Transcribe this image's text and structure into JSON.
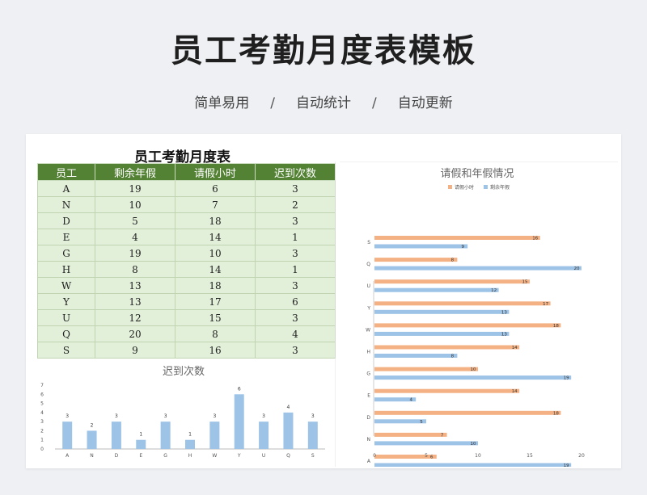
{
  "page": {
    "title": "员工考勤月度表模板",
    "features": [
      "简单易用",
      "自动统计",
      "自动更新"
    ],
    "separator": "/"
  },
  "table": {
    "title": "员工考勤月度表",
    "headers": [
      "员工",
      "剩余年假",
      "请假小时",
      "迟到次数"
    ],
    "rows": [
      [
        "A",
        "19",
        "6",
        "3"
      ],
      [
        "N",
        "10",
        "7",
        "2"
      ],
      [
        "D",
        "5",
        "18",
        "3"
      ],
      [
        "E",
        "4",
        "14",
        "1"
      ],
      [
        "G",
        "19",
        "10",
        "3"
      ],
      [
        "H",
        "8",
        "14",
        "1"
      ],
      [
        "W",
        "13",
        "18",
        "3"
      ],
      [
        "Y",
        "13",
        "17",
        "6"
      ],
      [
        "U",
        "12",
        "15",
        "3"
      ],
      [
        "Q",
        "20",
        "8",
        "4"
      ],
      [
        "S",
        "9",
        "16",
        "3"
      ]
    ],
    "colors": {
      "header_bg": "#548235",
      "cell_bg": "#e2efd9"
    }
  },
  "chart_data": [
    {
      "type": "bar",
      "title": "迟到次数",
      "categories": [
        "A",
        "N",
        "D",
        "E",
        "G",
        "H",
        "W",
        "Y",
        "U",
        "Q",
        "S"
      ],
      "values": [
        3,
        2,
        3,
        1,
        3,
        1,
        3,
        6,
        3,
        4,
        3
      ],
      "ylim": [
        0,
        7
      ],
      "yticks": [
        0,
        1,
        2,
        3,
        4,
        5,
        6,
        7
      ],
      "data_labels": true,
      "grid": false,
      "color": "#9dc3e6"
    },
    {
      "type": "bar",
      "orientation": "horizontal",
      "title": "请假和年假情况",
      "categories": [
        "S",
        "Q",
        "U",
        "Y",
        "W",
        "H",
        "G",
        "E",
        "D",
        "N",
        "A"
      ],
      "series": [
        {
          "name": "请假小时",
          "values": [
            16,
            8,
            15,
            17,
            18,
            14,
            10,
            14,
            18,
            7,
            6
          ],
          "color": "#f4b183"
        },
        {
          "name": "剩余年假",
          "values": [
            9,
            20,
            12,
            13,
            13,
            8,
            19,
            4,
            5,
            10,
            19
          ],
          "color": "#9dc3e6"
        }
      ],
      "xlim": [
        0,
        25
      ],
      "xticks": [
        0,
        5,
        10,
        15,
        20,
        25
      ],
      "legend": "top",
      "data_labels": true,
      "grid": false
    }
  ]
}
